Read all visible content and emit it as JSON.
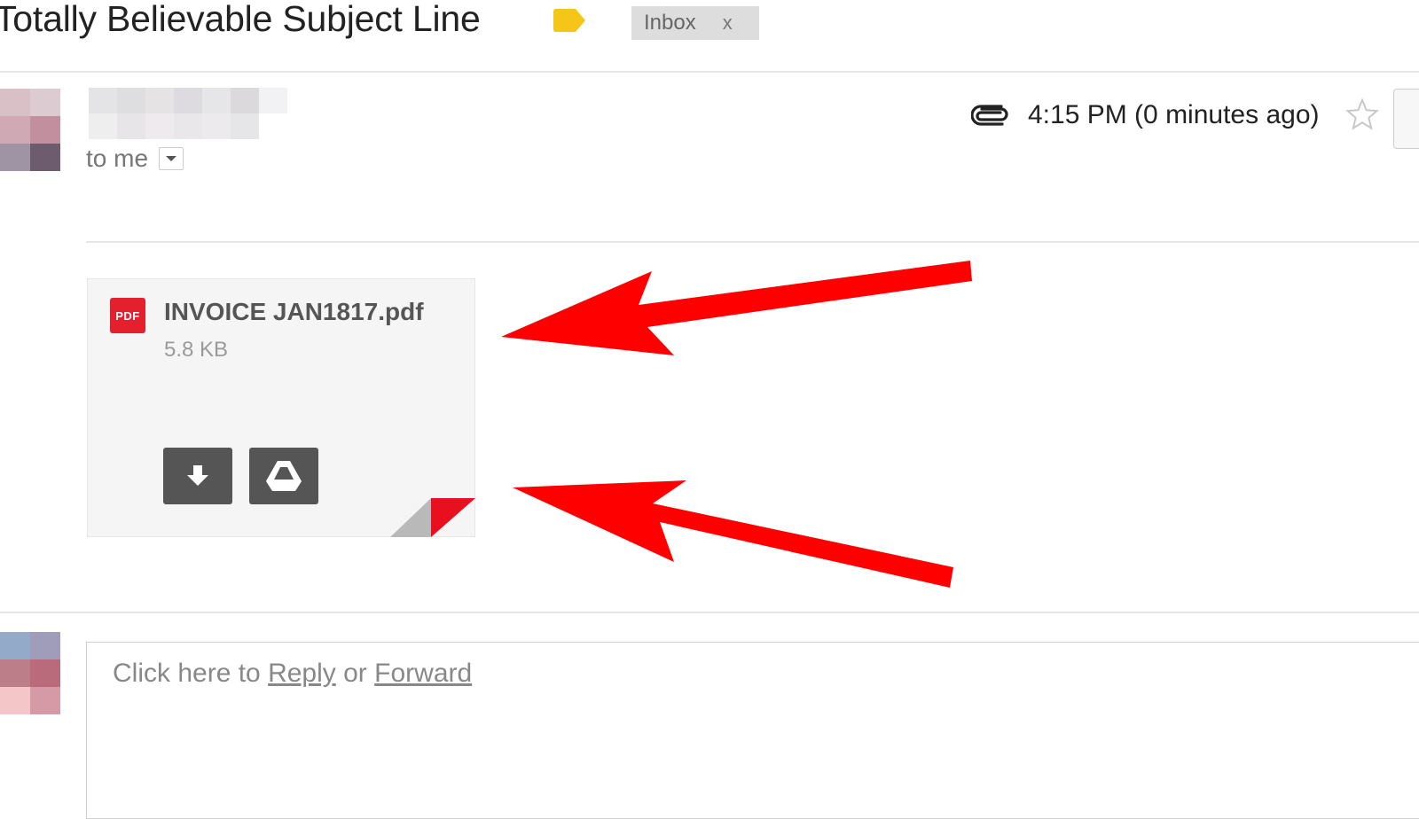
{
  "header": {
    "subject": "Totally Believable Subject Line",
    "label_color": "#f5c518",
    "chip_label": "Inbox",
    "chip_remove": "x"
  },
  "message": {
    "recipient_text": "to me",
    "timestamp": "4:15 PM (0 minutes ago)",
    "icons": [
      "paperclip-icon",
      "star-icon",
      "chevron-down-icon"
    ]
  },
  "attachment": {
    "badge": "PDF",
    "file_name": "INVOICE JAN1817.pdf",
    "file_size": "5.8 KB",
    "actions": [
      "download-icon",
      "google-drive-icon"
    ]
  },
  "reply": {
    "prompt_prefix": "Click here to",
    "reply_link": "Reply",
    "or_text": "or",
    "forward_link": "Forward"
  },
  "colors": {
    "accent_red": "#ff0000",
    "pdf_red": "#e4202e",
    "button_dark": "#555555",
    "label_yellow": "#f5c518"
  }
}
